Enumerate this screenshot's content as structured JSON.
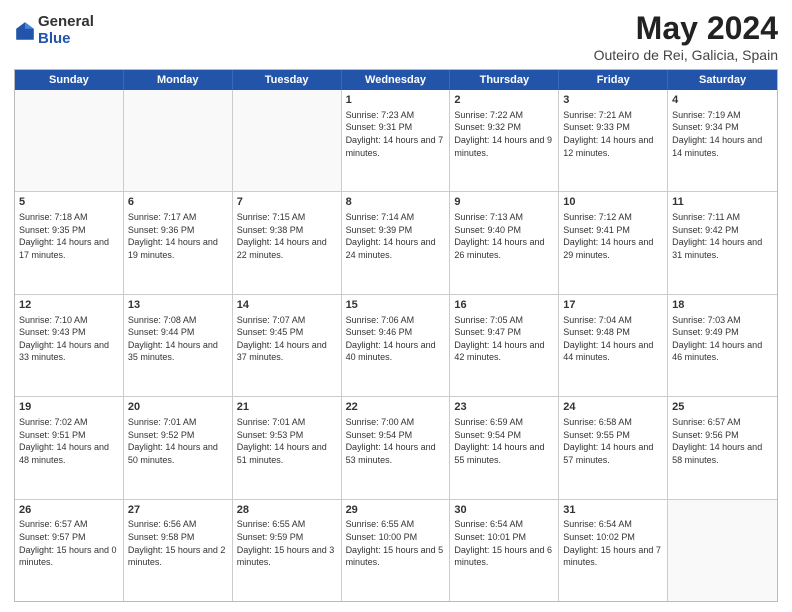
{
  "logo": {
    "general": "General",
    "blue": "Blue"
  },
  "title": "May 2024",
  "subtitle": "Outeiro de Rei, Galicia, Spain",
  "days": [
    "Sunday",
    "Monday",
    "Tuesday",
    "Wednesday",
    "Thursday",
    "Friday",
    "Saturday"
  ],
  "weeks": [
    [
      {
        "day": "",
        "content": "",
        "empty": true
      },
      {
        "day": "",
        "content": "",
        "empty": true
      },
      {
        "day": "",
        "content": "",
        "empty": true
      },
      {
        "day": "1",
        "content": "Sunrise: 7:23 AM\nSunset: 9:31 PM\nDaylight: 14 hours and 7 minutes."
      },
      {
        "day": "2",
        "content": "Sunrise: 7:22 AM\nSunset: 9:32 PM\nDaylight: 14 hours and 9 minutes."
      },
      {
        "day": "3",
        "content": "Sunrise: 7:21 AM\nSunset: 9:33 PM\nDaylight: 14 hours and 12 minutes."
      },
      {
        "day": "4",
        "content": "Sunrise: 7:19 AM\nSunset: 9:34 PM\nDaylight: 14 hours and 14 minutes."
      }
    ],
    [
      {
        "day": "5",
        "content": "Sunrise: 7:18 AM\nSunset: 9:35 PM\nDaylight: 14 hours and 17 minutes."
      },
      {
        "day": "6",
        "content": "Sunrise: 7:17 AM\nSunset: 9:36 PM\nDaylight: 14 hours and 19 minutes."
      },
      {
        "day": "7",
        "content": "Sunrise: 7:15 AM\nSunset: 9:38 PM\nDaylight: 14 hours and 22 minutes."
      },
      {
        "day": "8",
        "content": "Sunrise: 7:14 AM\nSunset: 9:39 PM\nDaylight: 14 hours and 24 minutes."
      },
      {
        "day": "9",
        "content": "Sunrise: 7:13 AM\nSunset: 9:40 PM\nDaylight: 14 hours and 26 minutes."
      },
      {
        "day": "10",
        "content": "Sunrise: 7:12 AM\nSunset: 9:41 PM\nDaylight: 14 hours and 29 minutes."
      },
      {
        "day": "11",
        "content": "Sunrise: 7:11 AM\nSunset: 9:42 PM\nDaylight: 14 hours and 31 minutes."
      }
    ],
    [
      {
        "day": "12",
        "content": "Sunrise: 7:10 AM\nSunset: 9:43 PM\nDaylight: 14 hours and 33 minutes."
      },
      {
        "day": "13",
        "content": "Sunrise: 7:08 AM\nSunset: 9:44 PM\nDaylight: 14 hours and 35 minutes."
      },
      {
        "day": "14",
        "content": "Sunrise: 7:07 AM\nSunset: 9:45 PM\nDaylight: 14 hours and 37 minutes."
      },
      {
        "day": "15",
        "content": "Sunrise: 7:06 AM\nSunset: 9:46 PM\nDaylight: 14 hours and 40 minutes."
      },
      {
        "day": "16",
        "content": "Sunrise: 7:05 AM\nSunset: 9:47 PM\nDaylight: 14 hours and 42 minutes."
      },
      {
        "day": "17",
        "content": "Sunrise: 7:04 AM\nSunset: 9:48 PM\nDaylight: 14 hours and 44 minutes."
      },
      {
        "day": "18",
        "content": "Sunrise: 7:03 AM\nSunset: 9:49 PM\nDaylight: 14 hours and 46 minutes."
      }
    ],
    [
      {
        "day": "19",
        "content": "Sunrise: 7:02 AM\nSunset: 9:51 PM\nDaylight: 14 hours and 48 minutes."
      },
      {
        "day": "20",
        "content": "Sunrise: 7:01 AM\nSunset: 9:52 PM\nDaylight: 14 hours and 50 minutes."
      },
      {
        "day": "21",
        "content": "Sunrise: 7:01 AM\nSunset: 9:53 PM\nDaylight: 14 hours and 51 minutes."
      },
      {
        "day": "22",
        "content": "Sunrise: 7:00 AM\nSunset: 9:54 PM\nDaylight: 14 hours and 53 minutes."
      },
      {
        "day": "23",
        "content": "Sunrise: 6:59 AM\nSunset: 9:54 PM\nDaylight: 14 hours and 55 minutes."
      },
      {
        "day": "24",
        "content": "Sunrise: 6:58 AM\nSunset: 9:55 PM\nDaylight: 14 hours and 57 minutes."
      },
      {
        "day": "25",
        "content": "Sunrise: 6:57 AM\nSunset: 9:56 PM\nDaylight: 14 hours and 58 minutes."
      }
    ],
    [
      {
        "day": "26",
        "content": "Sunrise: 6:57 AM\nSunset: 9:57 PM\nDaylight: 15 hours and 0 minutes."
      },
      {
        "day": "27",
        "content": "Sunrise: 6:56 AM\nSunset: 9:58 PM\nDaylight: 15 hours and 2 minutes."
      },
      {
        "day": "28",
        "content": "Sunrise: 6:55 AM\nSunset: 9:59 PM\nDaylight: 15 hours and 3 minutes."
      },
      {
        "day": "29",
        "content": "Sunrise: 6:55 AM\nSunset: 10:00 PM\nDaylight: 15 hours and 5 minutes."
      },
      {
        "day": "30",
        "content": "Sunrise: 6:54 AM\nSunset: 10:01 PM\nDaylight: 15 hours and 6 minutes."
      },
      {
        "day": "31",
        "content": "Sunrise: 6:54 AM\nSunset: 10:02 PM\nDaylight: 15 hours and 7 minutes."
      },
      {
        "day": "",
        "content": "",
        "empty": true
      }
    ]
  ]
}
